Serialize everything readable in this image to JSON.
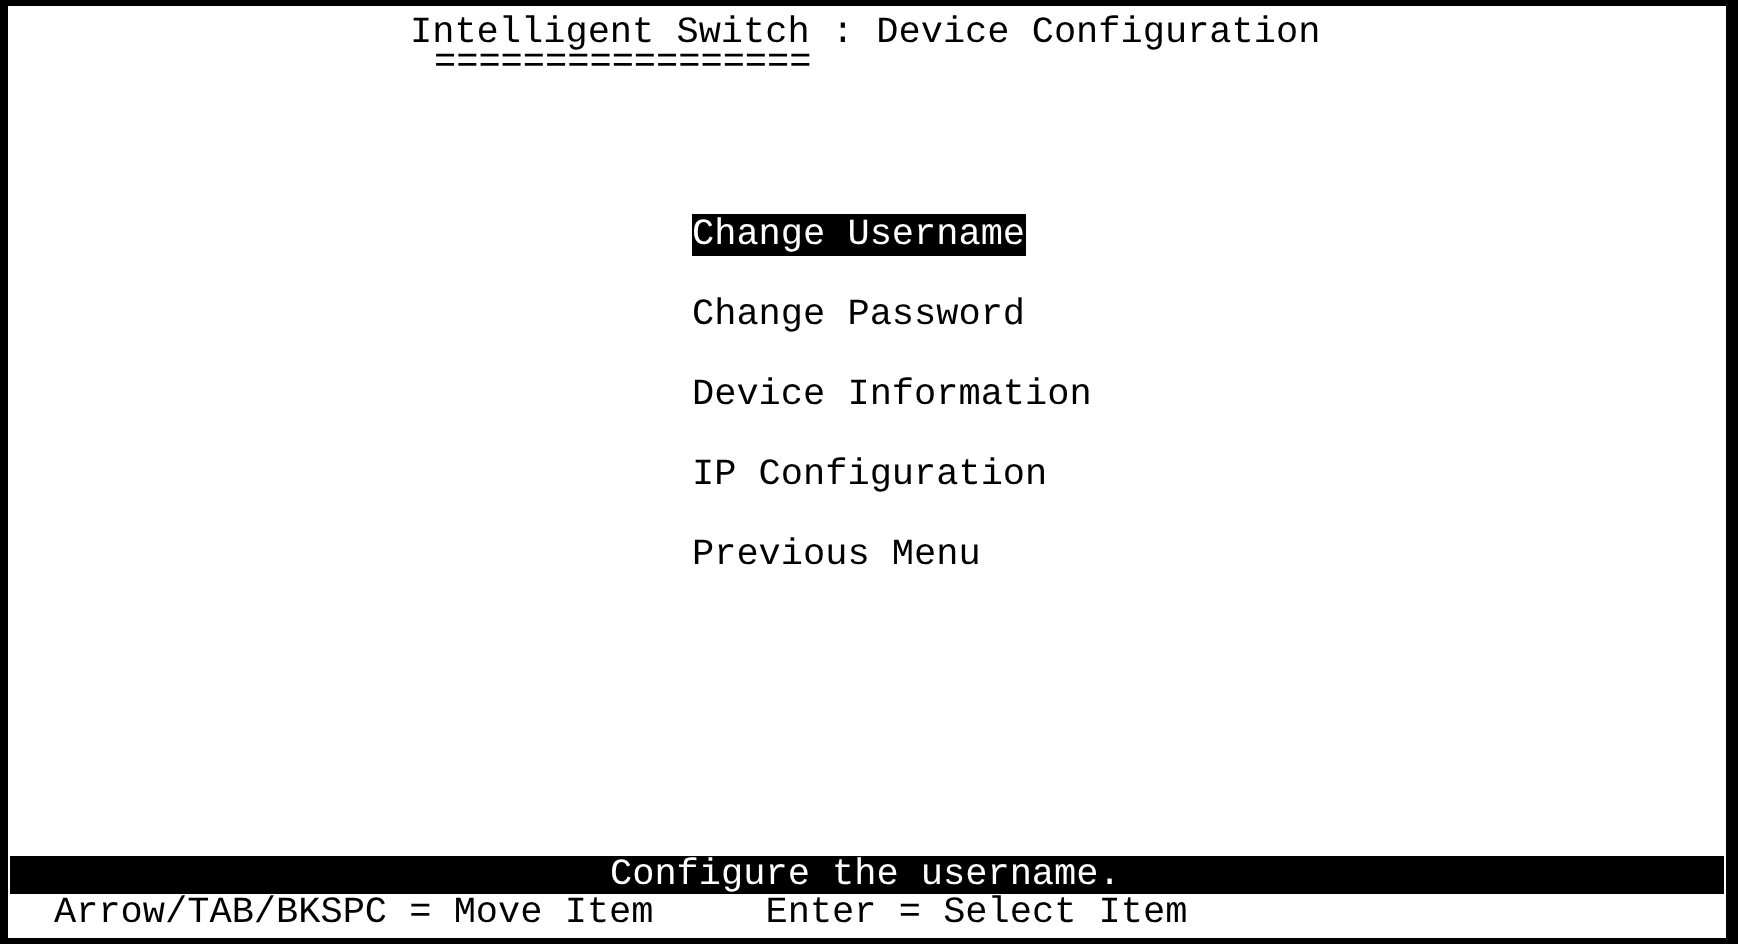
{
  "title": "Intelligent Switch : Device Configuration",
  "title_underline": "=================",
  "menu": [
    {
      "label": "Change Username",
      "selected": true
    },
    {
      "label": "Change Password",
      "selected": false
    },
    {
      "label": "Device Information",
      "selected": false
    },
    {
      "label": "IP Configuration",
      "selected": false
    },
    {
      "label": "Previous Menu",
      "selected": false
    }
  ],
  "status_message": "Configure the username.",
  "help": [
    "Arrow/TAB/BKSPC = Move Item",
    "Enter = Select Item"
  ]
}
